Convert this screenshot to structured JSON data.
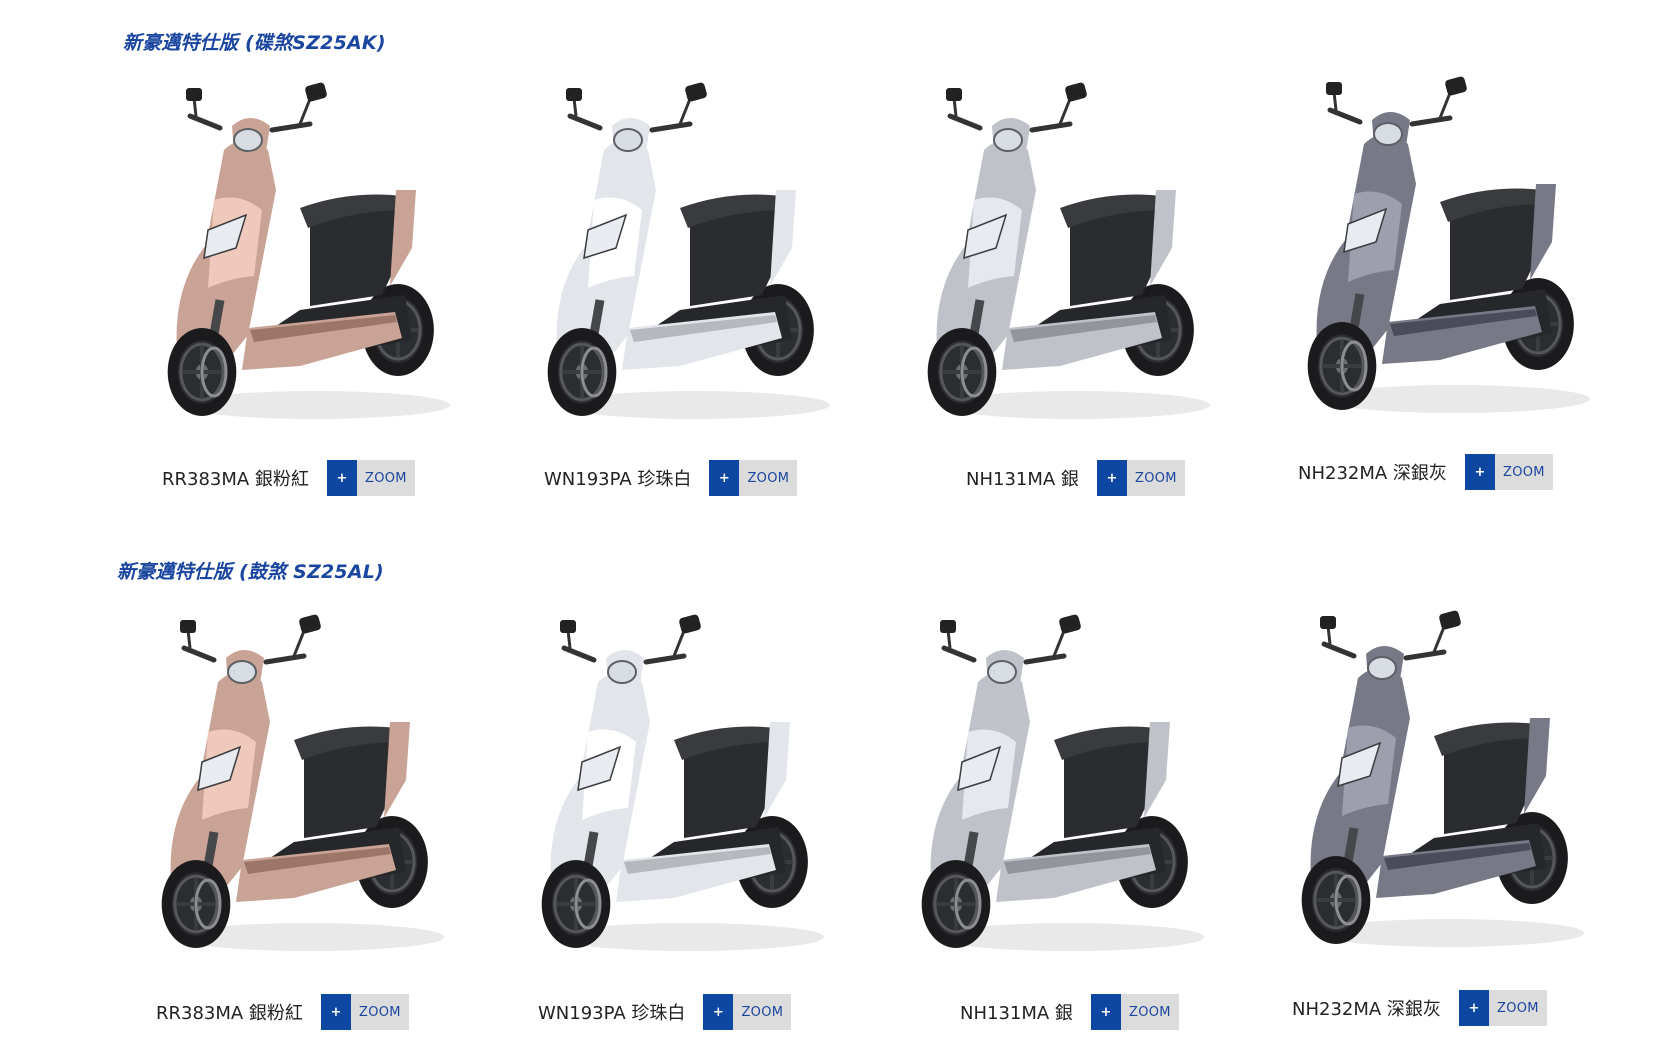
{
  "sections": [
    {
      "title": "新豪邁特仕版 (碟煞SZ25AK)",
      "items": [
        {
          "model": "RR383MA 銀粉紅",
          "color": "#c9a395",
          "zoom": "ZOOM",
          "plus": "+"
        },
        {
          "model": "WN193PA 珍珠白",
          "color": "#e2e5ea",
          "zoom": "ZOOM",
          "plus": "+"
        },
        {
          "model": "NH131MA 銀",
          "color": "#bfc2c8",
          "zoom": "ZOOM",
          "plus": "+"
        },
        {
          "model": "NH232MA 深銀灰",
          "color": "#777a86",
          "zoom": "ZOOM",
          "plus": "+"
        }
      ]
    },
    {
      "title": "新豪邁特仕版 (鼓煞 SZ25AL)",
      "items": [
        {
          "model": "RR383MA 銀粉紅",
          "color": "#c9a395",
          "zoom": "ZOOM",
          "plus": "+"
        },
        {
          "model": "WN193PA 珍珠白",
          "color": "#e2e5ea",
          "zoom": "ZOOM",
          "plus": "+"
        },
        {
          "model": "NH131MA 銀",
          "color": "#bfc2c8",
          "zoom": "ZOOM",
          "plus": "+"
        },
        {
          "model": "NH232MA 深銀灰",
          "color": "#777a86",
          "zoom": "ZOOM",
          "plus": "+"
        }
      ]
    }
  ]
}
